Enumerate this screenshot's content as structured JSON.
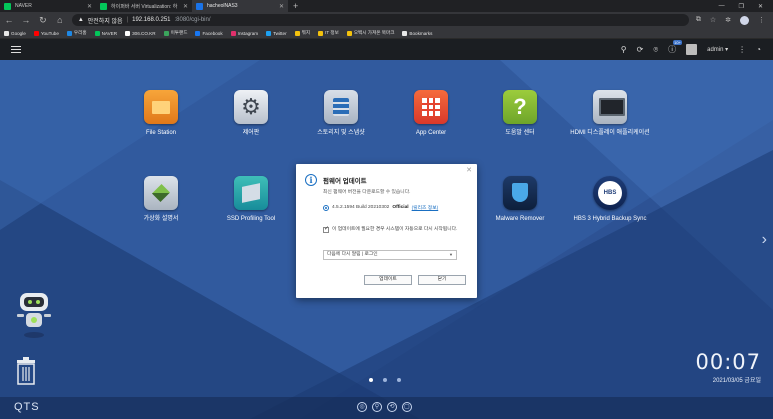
{
  "browser": {
    "tabs": [
      {
        "title": "NAVER",
        "color": "#03c75a",
        "active": false
      },
      {
        "title": "하이퍼바 서버 Virtualization: 하",
        "color": "#03c75a",
        "active": false
      },
      {
        "title": "hacheolNAS3",
        "color": "#1a73e8",
        "active": true
      }
    ],
    "address": {
      "warning": "안전하지 않음",
      "host": "192.168.0.251",
      "path": ":8080/cgi-bin/"
    },
    "bookmarks": [
      {
        "label": "Google",
        "color": "#e8e8e8"
      },
      {
        "label": "YouTube",
        "color": "#ff0000"
      },
      {
        "label": "우리홈",
        "color": "#1e88e5"
      },
      {
        "label": "NAVER",
        "color": "#03c75a"
      },
      {
        "label": "306.CO.KR",
        "color": "#ffffff"
      },
      {
        "label": "이투랜드",
        "color": "#3ba55c"
      },
      {
        "label": "Facebook",
        "color": "#1877f2"
      },
      {
        "label": "Instagram",
        "color": "#e1306c"
      },
      {
        "label": "Twitter",
        "color": "#1da1f2"
      },
      {
        "label": "뭐지",
        "color": "#f4c20d"
      },
      {
        "label": "IT 정보",
        "color": "#f4c20d"
      },
      {
        "label": "오백시 가져온 북마크",
        "color": "#f4c20d"
      },
      {
        "label": "Bookmarks",
        "color": "#e8e8e8"
      }
    ]
  },
  "qts": {
    "user": "admin ▾",
    "badge_count": "10+",
    "logo": "QTS",
    "accent": "#1a6fc2"
  },
  "apps": [
    {
      "label": "File Station",
      "icon": "file-station-icon"
    },
    {
      "label": "제어판",
      "icon": "control-panel-icon"
    },
    {
      "label": "스토리지 및 스냅샷",
      "icon": "storage-snapshots-icon"
    },
    {
      "label": "App Center",
      "icon": "app-center-icon"
    },
    {
      "label": "도움말 센터",
      "icon": "help-center-icon"
    },
    {
      "label": "HDMI 디스플레이 애플리케이션",
      "icon": "hdmi-display-icon"
    },
    {
      "label": "가상화 설명서",
      "icon": "virtualization-guide-icon"
    },
    {
      "label": "SSD Profiling Tool",
      "icon": "ssd-profiling-icon"
    },
    {
      "label": "Malware Remover",
      "icon": "malware-remover-icon"
    },
    {
      "label": "HBS 3 Hybrid Backup Sync",
      "icon": "hbs-icon"
    }
  ],
  "clock": {
    "time": "00:07",
    "date": "2021/03/05 금요일"
  },
  "dialog": {
    "title": "펌웨어 업데이트",
    "subtitle": "최신 펌웨어 버전을 다운로드할 수 있습니다.",
    "version": "4.5.2.1594 Build 20210302",
    "version_tag": "Official",
    "release_notes": "(릴리즈 정보)",
    "checkbox_label": "이 업데이트에 필요한 경우 시스템이 자동으로 다시 시작됩니다.",
    "select_value": "다음에 다시 알림 | 로그인",
    "update_button": "업데이트",
    "close_button": "닫기"
  }
}
